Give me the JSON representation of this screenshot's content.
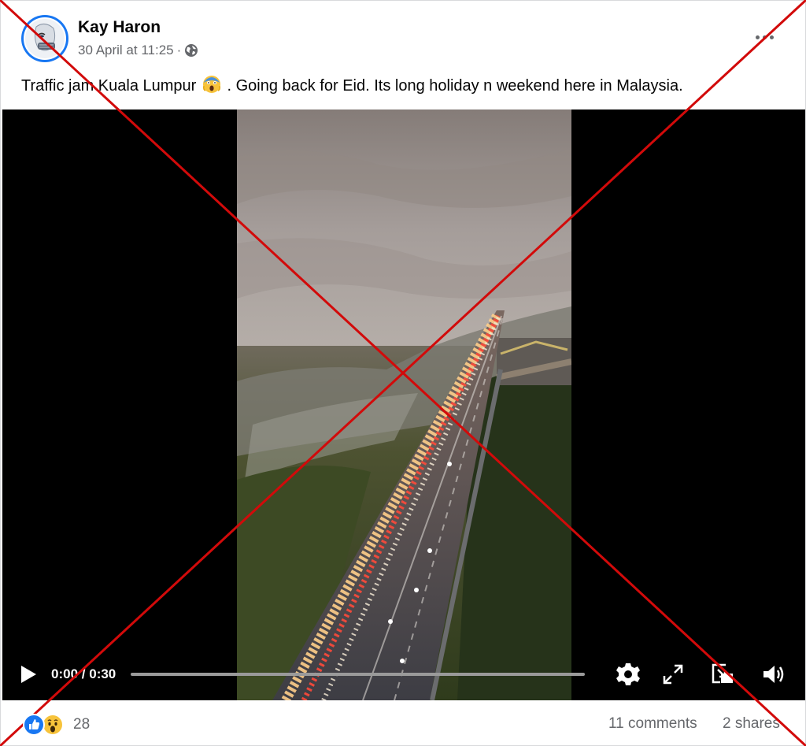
{
  "post": {
    "author": "Kay Haron",
    "timestamp": "30 April at 11:25",
    "separator": "·",
    "audience_icon": "globe-icon",
    "more_icon": "more-options-icon",
    "text_before_emoji": "Traffic jam Kuala Lumpur",
    "emoji_icon": "face-screaming-emoji",
    "text_after_emoji": ". Going back for Eid. Its long holiday n weekend here in Malaysia."
  },
  "video": {
    "current_time": "0:00",
    "time_separator": "/",
    "duration": "0:30",
    "progress_fraction": 0.0,
    "icons": [
      "play-icon",
      "gear-icon",
      "fullscreen-icon",
      "pip-icon",
      "volume-icon"
    ]
  },
  "footer": {
    "reaction_icons": [
      "like-reaction-icon",
      "wow-reaction-icon"
    ],
    "reaction_count": "28",
    "comments": "11 comments",
    "shares": "2 shares"
  },
  "overlay": {
    "cross_color": "#d20a0a"
  },
  "colors": {
    "accent": "#1877f2",
    "secondary_text": "#65676b"
  }
}
